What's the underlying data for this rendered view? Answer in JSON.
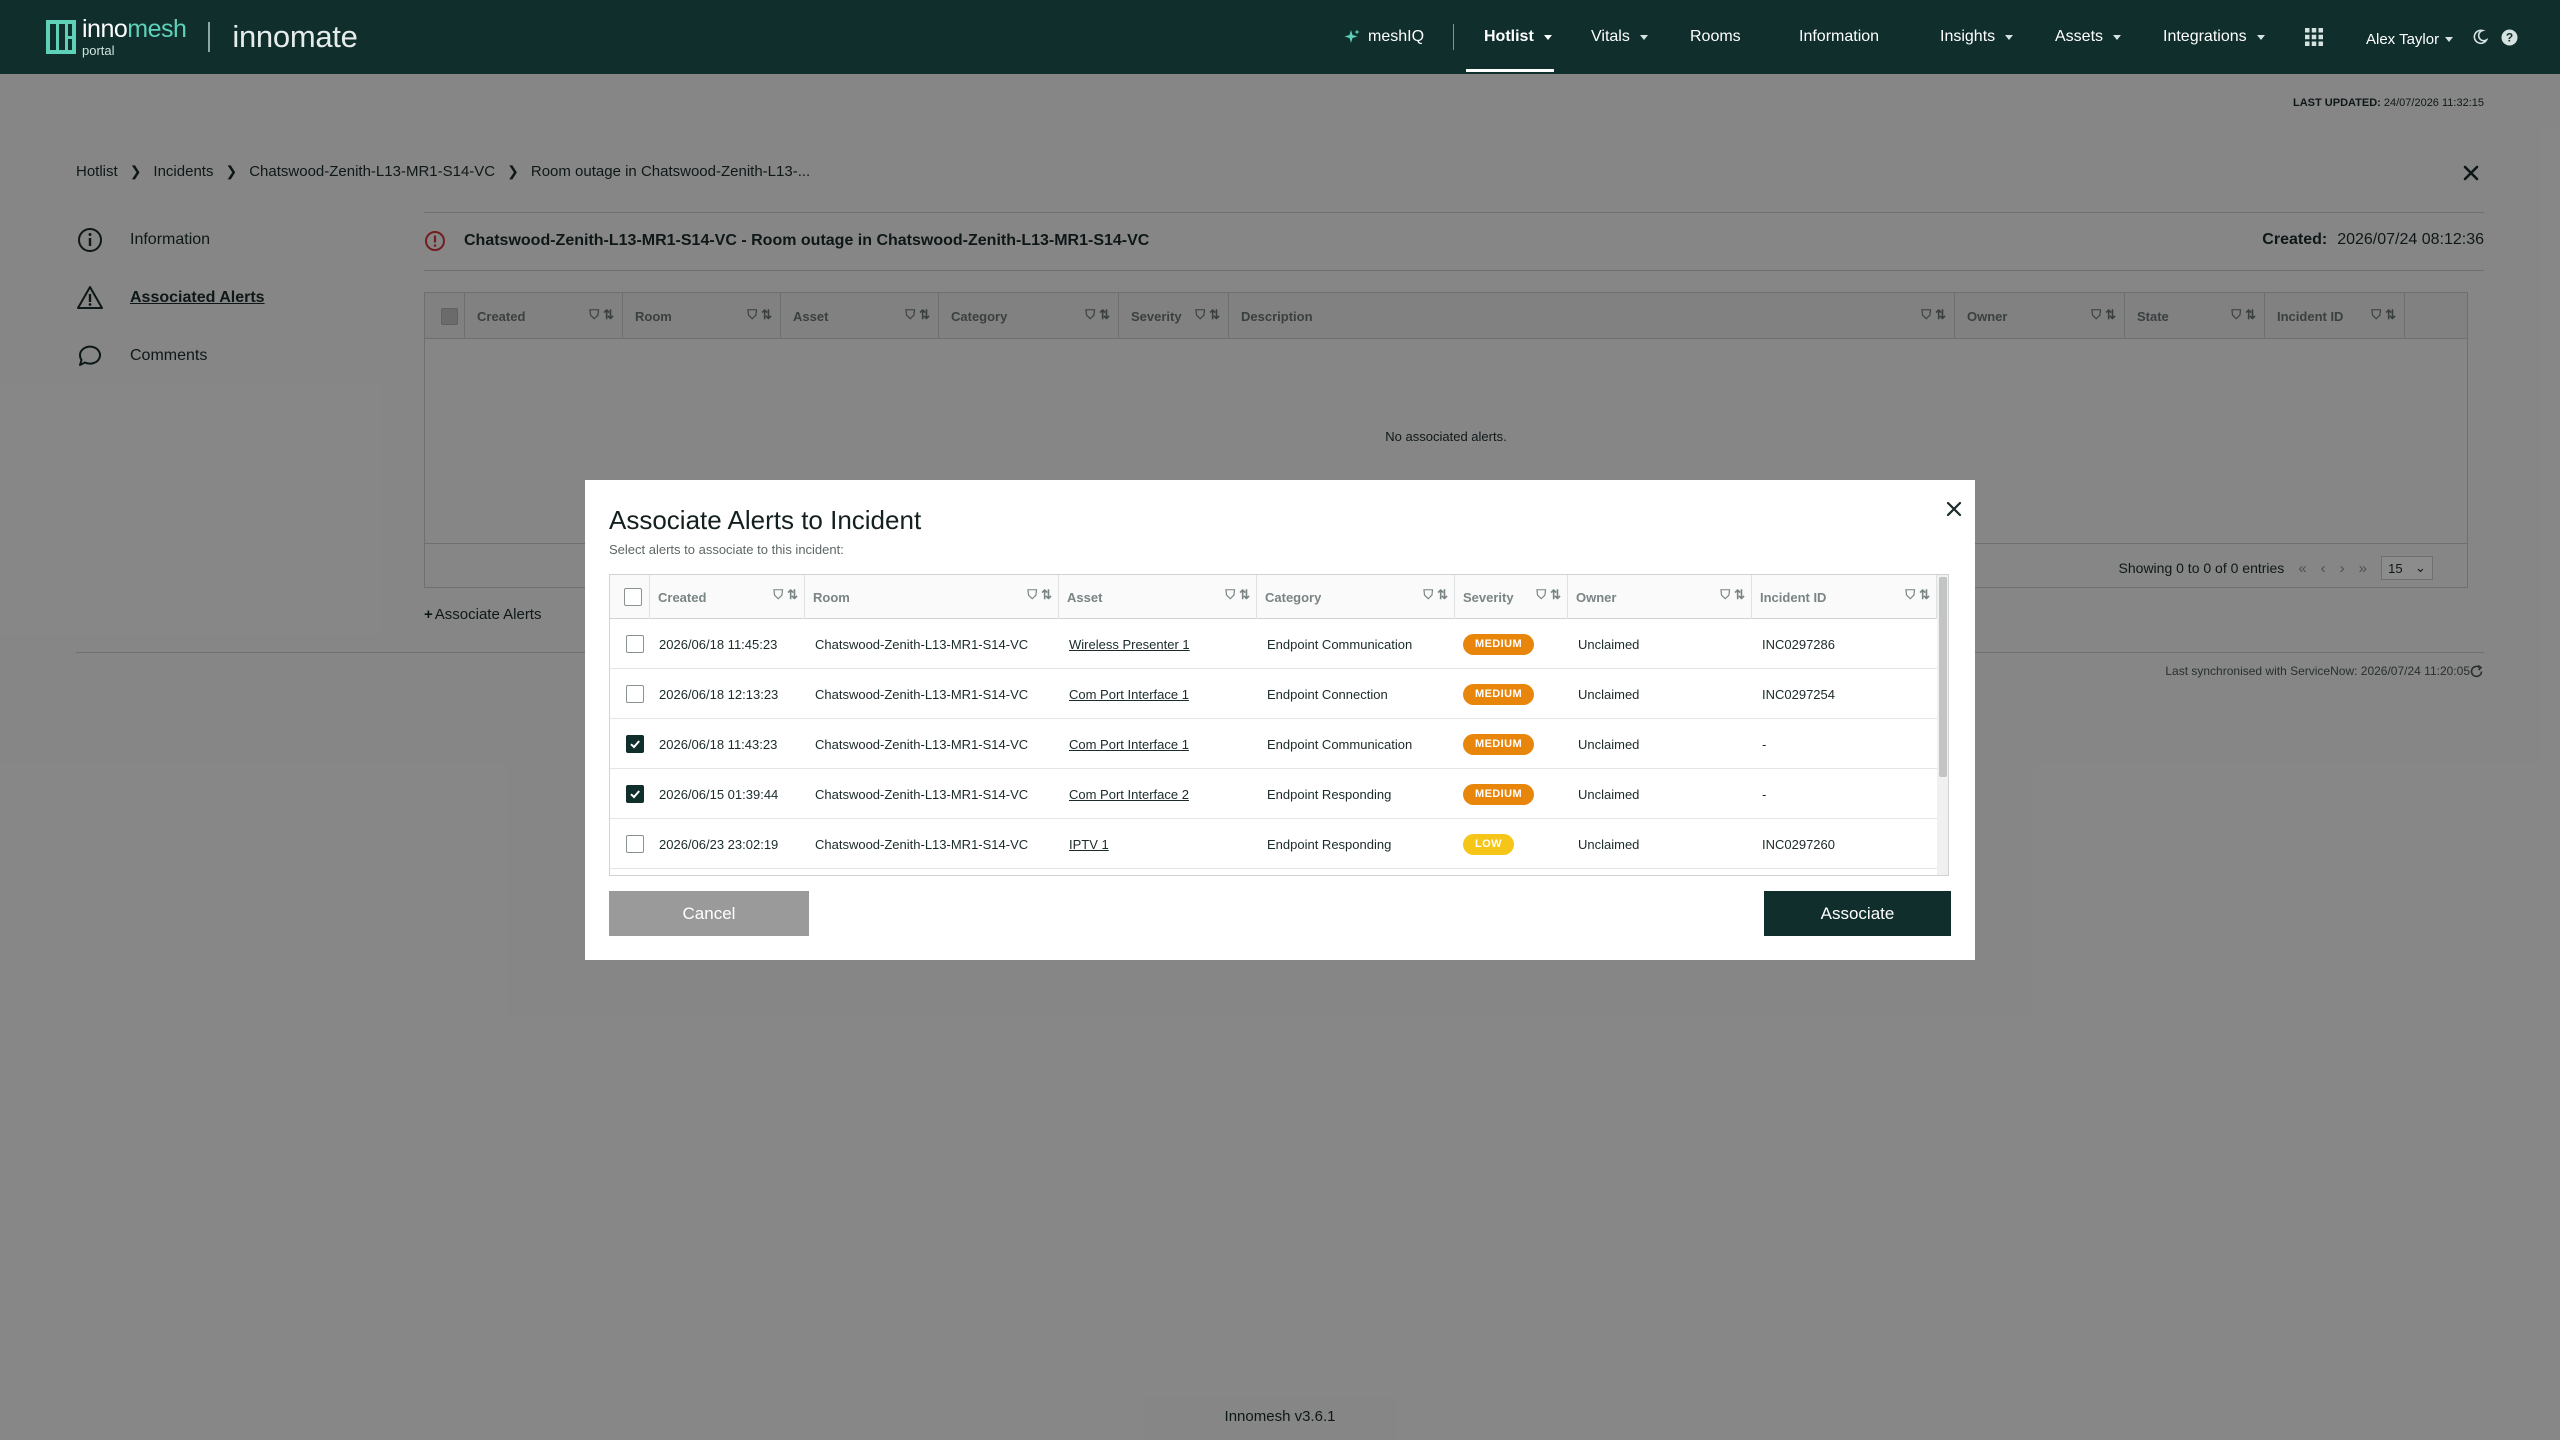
{
  "brand": {
    "logo_inno": "inno",
    "logo_mesh": "mesh",
    "logo_sub": "portal",
    "app_name": "innomate"
  },
  "nav": {
    "meshiq": "meshIQ",
    "hotlist": "Hotlist",
    "vitals": "Vitals",
    "rooms": "Rooms",
    "information": "Information",
    "insights": "Insights",
    "assets": "Assets",
    "integrations": "Integrations",
    "user": "Alex Taylor"
  },
  "last_updated": {
    "label": "LAST UPDATED:",
    "value": "24/07/2026 11:32:15"
  },
  "breadcrumb": [
    "Hotlist",
    "Incidents",
    "Chatswood-Zenith-L13-MR1-S14-VC",
    "Room outage in Chatswood-Zenith-L13-..."
  ],
  "sidenav": {
    "information": "Information",
    "associated_alerts": "Associated Alerts",
    "comments": "Comments"
  },
  "incident": {
    "title": "Chatswood-Zenith-L13-MR1-S14-VC - Room outage in Chatswood-Zenith-L13-MR1-S14-VC",
    "created_label": "Created:",
    "created_value": "2026/07/24 08:12:36"
  },
  "bg_table": {
    "columns": [
      "Created",
      "Room",
      "Asset",
      "Category",
      "Severity",
      "Description",
      "Owner",
      "State",
      "Incident ID"
    ],
    "empty_text": "No associated alerts.",
    "showing": "Showing 0 to 0 of 0 entries",
    "page_size": "15"
  },
  "associate_link": "Associate Alerts",
  "sync_text": "Last synchronised with ServiceNow: 2026/07/24 11:20:05",
  "footer_version": "Innomesh v3.6.1",
  "modal": {
    "title": "Associate Alerts to Incident",
    "subtitle": "Select alerts to associate to this incident:",
    "columns": [
      "Created",
      "Room",
      "Asset",
      "Category",
      "Severity",
      "Owner",
      "Incident ID"
    ],
    "rows": [
      {
        "checked": false,
        "created": "2026/06/18 11:45:23",
        "room": "Chatswood-Zenith-L13-MR1-S14-VC",
        "asset": "Wireless Presenter 1",
        "category": "Endpoint Communication",
        "severity": "MEDIUM",
        "owner": "Unclaimed",
        "incident_id": "INC0297286"
      },
      {
        "checked": false,
        "created": "2026/06/18 12:13:23",
        "room": "Chatswood-Zenith-L13-MR1-S14-VC",
        "asset": "Com Port Interface 1",
        "category": "Endpoint Connection",
        "severity": "MEDIUM",
        "owner": "Unclaimed",
        "incident_id": "INC0297254"
      },
      {
        "checked": true,
        "created": "2026/06/18 11:43:23",
        "room": "Chatswood-Zenith-L13-MR1-S14-VC",
        "asset": "Com Port Interface 1",
        "category": "Endpoint Communication",
        "severity": "MEDIUM",
        "owner": "Unclaimed",
        "incident_id": "-"
      },
      {
        "checked": true,
        "created": "2026/06/15 01:39:44",
        "room": "Chatswood-Zenith-L13-MR1-S14-VC",
        "asset": "Com Port Interface 2",
        "category": "Endpoint Responding",
        "severity": "MEDIUM",
        "owner": "Unclaimed",
        "incident_id": "-"
      },
      {
        "checked": false,
        "created": "2026/06/23 23:02:19",
        "room": "Chatswood-Zenith-L13-MR1-S14-VC",
        "asset": "IPTV 1",
        "category": "Endpoint Responding",
        "severity": "LOW",
        "owner": "Unclaimed",
        "incident_id": "INC0297260"
      }
    ],
    "cancel_label": "Cancel",
    "associate_label": "Associate"
  },
  "colors": {
    "topbar": "#0f2e2c",
    "medium": "#e8860b",
    "low": "#f5c517",
    "danger": "#d0383b"
  }
}
